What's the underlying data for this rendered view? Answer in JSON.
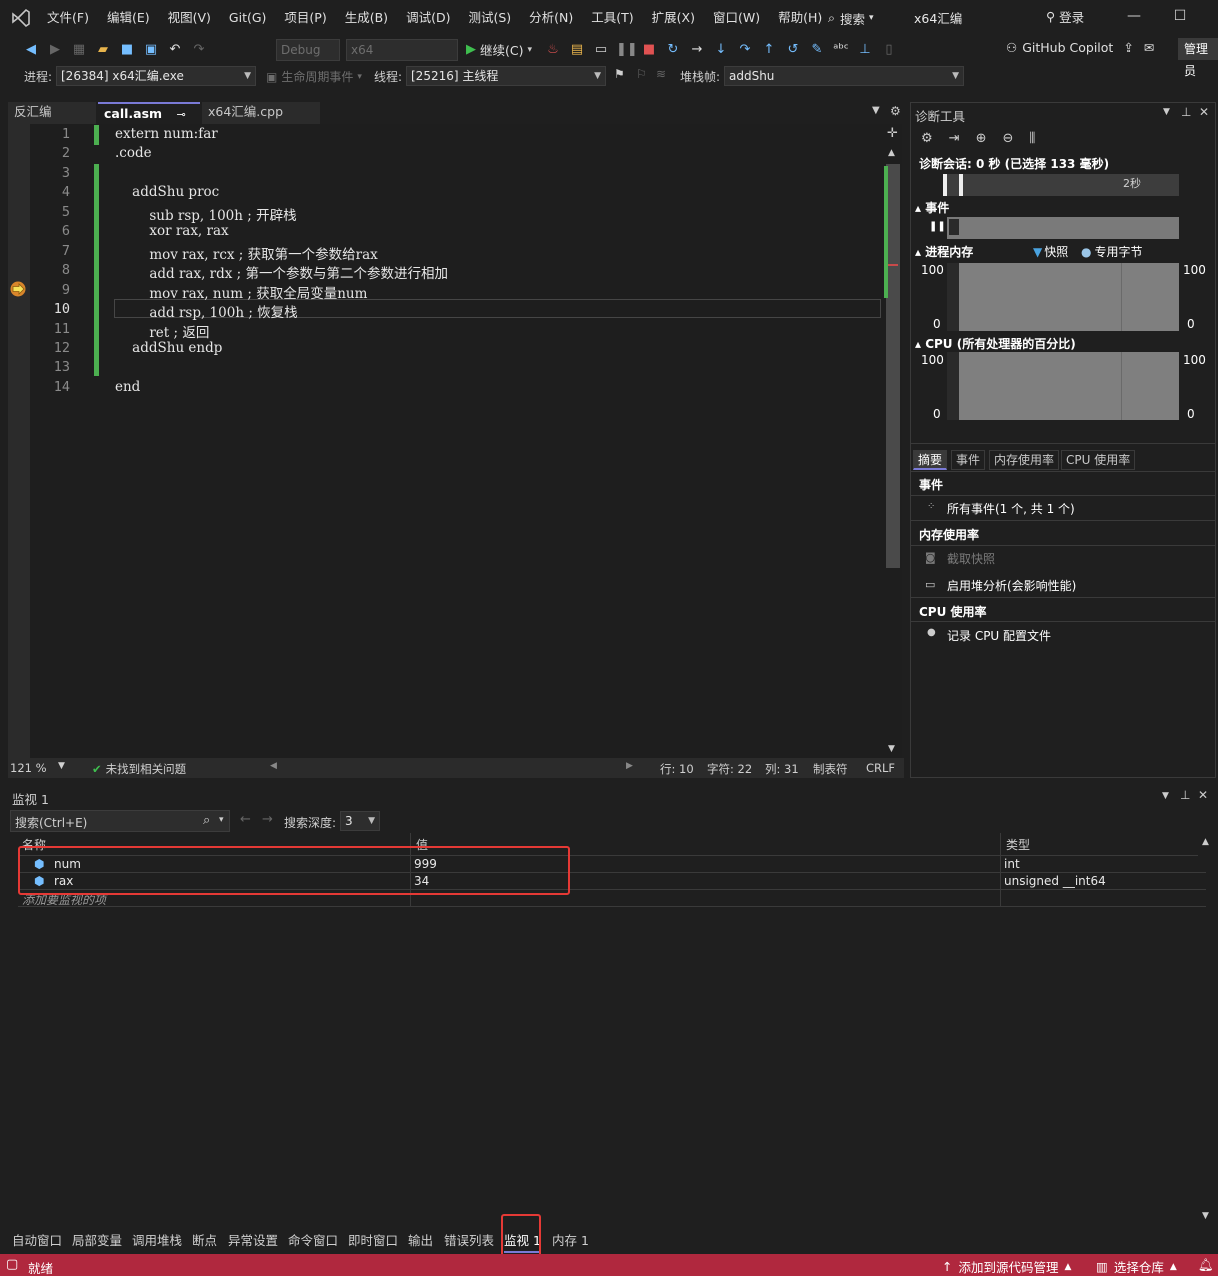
{
  "menubar": {
    "items": [
      "文件(F)",
      "编辑(E)",
      "视图(V)",
      "Git(G)",
      "项目(P)",
      "生成(B)",
      "调试(D)",
      "测试(S)",
      "分析(N)",
      "工具(T)",
      "扩展(X)",
      "窗口(W)",
      "帮助(H)"
    ],
    "search": "搜索",
    "title": "x64汇编",
    "login": "登录"
  },
  "toolbar": {
    "config": "Debug",
    "platform": "x64",
    "continue": "继续(C)",
    "copilot": "GitHub Copilot",
    "manage": "管理员"
  },
  "debugbar": {
    "process_label": "进程:",
    "process_value": "[26384] x64汇编.exe",
    "lifecycle": "生命周期事件",
    "thread_label": "线程:",
    "thread_value": "[25216] 主线程",
    "stack_label": "堆栈帧:",
    "stack_value": "addShu"
  },
  "doc_tabs": {
    "left": "反汇编",
    "active": "call.asm",
    "other": "x64汇编.cpp"
  },
  "editor": {
    "lines": [
      {
        "n": "1",
        "code": "extern num:far"
      },
      {
        "n": "2",
        "code": ".code"
      },
      {
        "n": "3",
        "code": ""
      },
      {
        "n": "4",
        "code": "    addShu proc"
      },
      {
        "n": "5",
        "code": "        sub rsp, 100h ; 开辟栈"
      },
      {
        "n": "6",
        "code": "        xor rax, rax"
      },
      {
        "n": "7",
        "code": "        mov rax, rcx ; 获取第一个参数给rax"
      },
      {
        "n": "8",
        "code": "        add rax, rdx ; 第一个参数与第二个参数进行相加"
      },
      {
        "n": "9",
        "code": "        mov rax, num ; 获取全局变量num"
      },
      {
        "n": "10",
        "code": "        add rsp, 100h ; 恢复栈"
      },
      {
        "n": "11",
        "code": "        ret ; 返回"
      },
      {
        "n": "12",
        "code": "    addShu endp"
      },
      {
        "n": "13",
        "code": ""
      },
      {
        "n": "14",
        "code": "end"
      }
    ],
    "current_line": "10"
  },
  "editor_status": {
    "zoom": "121 %",
    "issues": "未找到相关问题",
    "line": "行: 10",
    "char": "字符: 22",
    "col": "列: 31",
    "tabs": "制表符",
    "eol": "CRLF"
  },
  "diagnostics": {
    "title": "诊断工具",
    "session": "诊断会话: 0 秒 (已选择 133 毫秒)",
    "timeline_label": "2秒",
    "events_label": "事件",
    "memory_label": "进程内存",
    "snapshot_legend": "快照",
    "private_bytes_legend": "专用字节",
    "cpu_label": "CPU (所有处理器的百分比)",
    "axis_max": "100",
    "axis_min": "0",
    "tabs": [
      "摘要",
      "事件",
      "内存使用率",
      "CPU 使用率"
    ],
    "summary": {
      "events_header": "事件",
      "all_events": "所有事件(1 个, 共 1 个)",
      "memory_header": "内存使用率",
      "take_snapshot": "截取快照",
      "heap_profiling": "启用堆分析(会影响性能)",
      "cpu_header": "CPU 使用率",
      "record_cpu": "记录 CPU 配置文件"
    }
  },
  "watch": {
    "title": "监视 1",
    "search_placeholder": "搜索(Ctrl+E)",
    "depth_label": "搜索深度:",
    "depth_value": "3",
    "col_name": "名称",
    "col_value": "值",
    "col_type": "类型",
    "rows": [
      {
        "name": "num",
        "value": "999",
        "type": "int"
      },
      {
        "name": "rax",
        "value": "34",
        "type": "unsigned __int64"
      }
    ],
    "add_item": "添加要监视的项"
  },
  "bottom_tabs": [
    "自动窗口",
    "局部变量",
    "调用堆栈",
    "断点",
    "异常设置",
    "命令窗口",
    "即时窗口",
    "输出",
    "错误列表",
    "监视 1",
    "内存 1"
  ],
  "statusbar": {
    "ready": "就绪",
    "source_control": "添加到源代码管理",
    "repo": "选择仓库"
  },
  "colors": {
    "accent": "#7a7ad6",
    "statusbar": "#b0283e",
    "changebar": "#4caf50",
    "highlight_box": "#e53935"
  }
}
